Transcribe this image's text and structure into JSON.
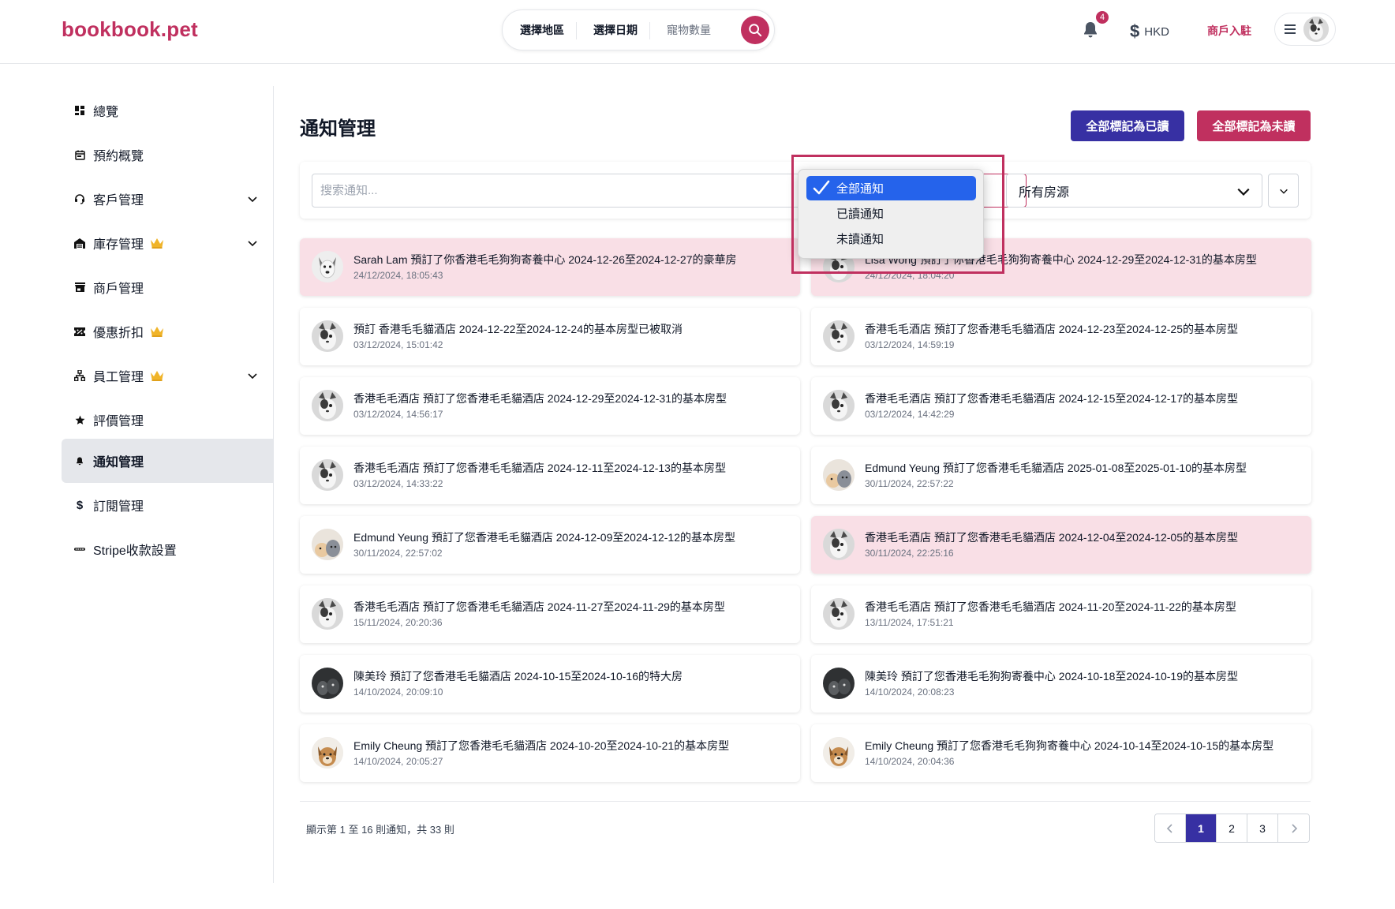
{
  "header": {
    "logo": "bookbook.pet",
    "search": {
      "region": "選擇地區",
      "date": "選擇日期",
      "pets": "寵物數量"
    },
    "notification_count": "4",
    "currency_symbol": "$",
    "currency": "HKD",
    "merchant_link": "商戶入駐"
  },
  "sidebar": {
    "items": [
      {
        "label": "總覽",
        "icon": "dashboard-icon"
      },
      {
        "label": "預約概覽",
        "icon": "calendar-icon"
      },
      {
        "label": "客戶管理",
        "icon": "headset-icon",
        "expandable": true
      },
      {
        "label": "庫存管理",
        "icon": "warehouse-icon",
        "premium": true,
        "expandable": true
      },
      {
        "label": "商戶管理",
        "icon": "store-icon"
      },
      {
        "label": "優惠折扣",
        "icon": "ticket-icon",
        "premium": true
      },
      {
        "label": "員工管理",
        "icon": "org-chart-icon",
        "premium": true,
        "expandable": true
      },
      {
        "label": "評價管理",
        "icon": "star-icon"
      },
      {
        "label": "通知管理",
        "icon": "bell-icon",
        "active": true
      },
      {
        "label": "訂閱管理",
        "icon": "dollar-icon"
      },
      {
        "label": "Stripe收款設置",
        "icon": "stripe-icon"
      }
    ]
  },
  "main": {
    "title": "通知管理",
    "mark_all_read": "全部標記為已讀",
    "mark_all_unread": "全部標記為未讀",
    "search_placeholder": "搜索通知...",
    "property_filter": "所有房源",
    "type_options": [
      "全部通知",
      "已讀通知",
      "未讀通知"
    ],
    "type_selected": "全部通知",
    "notifications": [
      {
        "text": "Sarah Lam 預訂了你香港毛毛狗狗寄養中心 2024-12-26至2024-12-27的豪華房",
        "time": "24/12/2024, 18:05:43",
        "unread": true,
        "avatar": "dog-avatar"
      },
      {
        "text": "Lisa Wong 預訂了你香港毛毛狗狗寄養中心 2024-12-29至2024-12-31的基本房型",
        "time": "24/12/2024, 18:04:20",
        "unread": true,
        "avatar": "cat-avatar"
      },
      {
        "text": "預訂 香港毛毛貓酒店 2024-12-22至2024-12-24的基本房型已被取消",
        "time": "03/12/2024, 15:01:42",
        "unread": false,
        "avatar": "cat-avatar"
      },
      {
        "text": "香港毛毛酒店 預訂了您香港毛毛貓酒店 2024-12-23至2024-12-25的基本房型",
        "time": "03/12/2024, 14:59:19",
        "unread": false,
        "avatar": "cat-avatar"
      },
      {
        "text": "香港毛毛酒店 預訂了您香港毛毛貓酒店 2024-12-29至2024-12-31的基本房型",
        "time": "03/12/2024, 14:56:17",
        "unread": false,
        "avatar": "cat-avatar"
      },
      {
        "text": "香港毛毛酒店 預訂了您香港毛毛貓酒店 2024-12-15至2024-12-17的基本房型",
        "time": "03/12/2024, 14:42:29",
        "unread": false,
        "avatar": "cat-avatar"
      },
      {
        "text": "香港毛毛酒店 預訂了您香港毛毛貓酒店 2024-12-11至2024-12-13的基本房型",
        "time": "03/12/2024, 14:33:22",
        "unread": false,
        "avatar": "cat-avatar"
      },
      {
        "text": "Edmund Yeung 預訂了您香港毛毛貓酒店 2025-01-08至2025-01-10的基本房型",
        "time": "30/11/2024, 22:57:22",
        "unread": false,
        "avatar": "pets-avatar"
      },
      {
        "text": "Edmund Yeung 預訂了您香港毛毛貓酒店 2024-12-09至2024-12-12的基本房型",
        "time": "30/11/2024, 22:57:02",
        "unread": false,
        "avatar": "pets-avatar"
      },
      {
        "text": "香港毛毛酒店 預訂了您香港毛毛貓酒店 2024-12-04至2024-12-05的基本房型",
        "time": "30/11/2024, 22:25:16",
        "unread": true,
        "avatar": "cat-avatar"
      },
      {
        "text": "香港毛毛酒店 預訂了您香港毛毛貓酒店 2024-11-27至2024-11-29的基本房型",
        "time": "15/11/2024, 20:20:36",
        "unread": false,
        "avatar": "cat-avatar"
      },
      {
        "text": "香港毛毛酒店 預訂了您香港毛毛貓酒店 2024-11-20至2024-11-22的基本房型",
        "time": "13/11/2024, 17:51:21",
        "unread": false,
        "avatar": "cat-avatar"
      },
      {
        "text": "陳美玲 預訂了您香港毛毛貓酒店 2024-10-15至2024-10-16的特大房",
        "time": "14/10/2024, 20:09:10",
        "unread": false,
        "avatar": "dark-avatar"
      },
      {
        "text": "陳美玲 預訂了您香港毛毛狗狗寄養中心 2024-10-18至2024-10-19的基本房型",
        "time": "14/10/2024, 20:08:23",
        "unread": false,
        "avatar": "dark-avatar"
      },
      {
        "text": "Emily Cheung 預訂了您香港毛毛貓酒店 2024-10-20至2024-10-21的基本房型",
        "time": "14/10/2024, 20:05:27",
        "unread": false,
        "avatar": "dog-brown-avatar"
      },
      {
        "text": "Emily Cheung 預訂了您香港毛毛狗狗寄養中心 2024-10-14至2024-10-15的基本房型",
        "time": "14/10/2024, 20:04:36",
        "unread": false,
        "avatar": "dog-brown-avatar"
      }
    ],
    "summary": "顯示第 1 至 16 則通知，共 33 則",
    "pages": [
      "1",
      "2",
      "3"
    ],
    "current_page": "1"
  },
  "colors": {
    "brand": "#c0305f",
    "primary": "#3730a3",
    "unread_bg": "#f9dfe6",
    "selected_option": "#2563eb"
  }
}
